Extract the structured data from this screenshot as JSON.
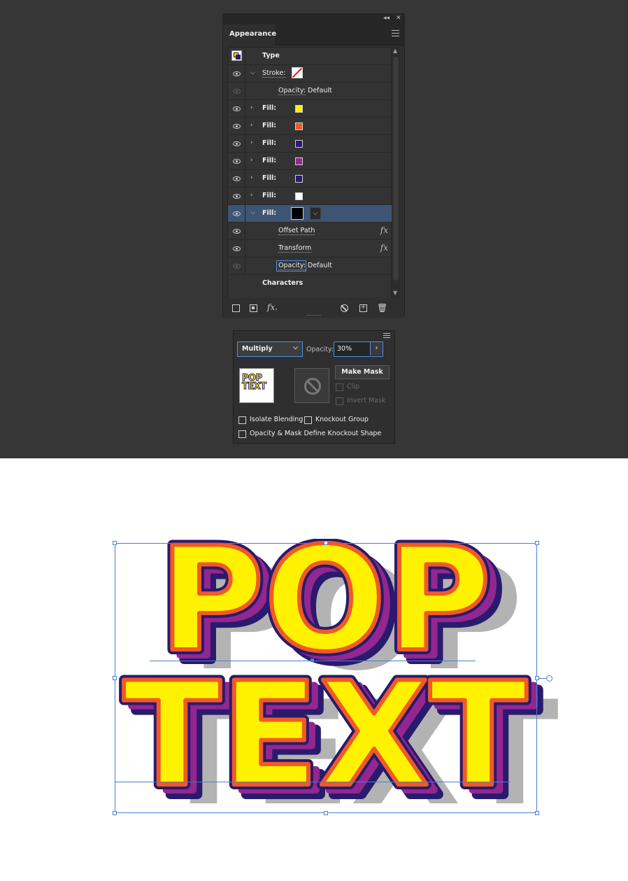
{
  "appearance_panel": {
    "tab_title": "Appearance",
    "collapse_glyph": "◂◂",
    "close_glyph": "✕",
    "target_type": "Type",
    "rows": [
      {
        "kind": "stroke",
        "label": "Stroke:",
        "expanded": true,
        "swatch": "none"
      },
      {
        "kind": "opacity",
        "label": "Opacity:",
        "value": "Default",
        "eye": "dim"
      },
      {
        "kind": "fill",
        "label": "Fill:",
        "color": "#FFF200"
      },
      {
        "kind": "fill",
        "label": "Fill:",
        "color": "#F15A24"
      },
      {
        "kind": "fill",
        "label": "Fill:",
        "color": "#2A1A6E"
      },
      {
        "kind": "fill",
        "label": "Fill:",
        "color": "#93278F"
      },
      {
        "kind": "fill",
        "label": "Fill:",
        "color": "#2A1A6E"
      },
      {
        "kind": "fill",
        "label": "Fill:",
        "color": "#FFFFFF"
      },
      {
        "kind": "fill-selected",
        "label": "Fill:",
        "color": "#000000",
        "expanded": true
      },
      {
        "kind": "effect",
        "label": "Offset Path",
        "fx": "fx"
      },
      {
        "kind": "effect",
        "label": "Transform",
        "fx": "fx"
      },
      {
        "kind": "opacity-focused",
        "label": "Opacity:",
        "value": "Default",
        "eye": "dim"
      }
    ],
    "characters_label": "Characters",
    "bottom_icons": [
      "new-stroke-icon",
      "new-fill-icon",
      "fx-icon",
      "clear-icon",
      "duplicate-icon",
      "delete-icon"
    ],
    "fx_button": "fx."
  },
  "transparency_panel": {
    "blend_mode": "Multiply",
    "opacity_label": "Opacity:",
    "opacity_value": "30%",
    "make_mask_label": "Make Mask",
    "clip_label": "Clip",
    "invert_mask_label": "Invert Mask",
    "isolate_blending_label": "Isolate Blending",
    "knockout_group_label": "Knockout Group",
    "opacity_mask_knockout_label": "Opacity & Mask Define Knockout Shape",
    "thumbnail_text_line1": "POP",
    "thumbnail_text_line2": "TEXT"
  },
  "artwork": {
    "line1": "POP",
    "line2": "TEXT",
    "colors": {
      "face": "#FFF200",
      "outline_orange": "#F15A24",
      "outline_navy": "#2A1A6E",
      "extrude_purple": "#93278F",
      "shadow_gray": "#B3B3B3",
      "selection_blue": "#4A7FD4"
    }
  }
}
